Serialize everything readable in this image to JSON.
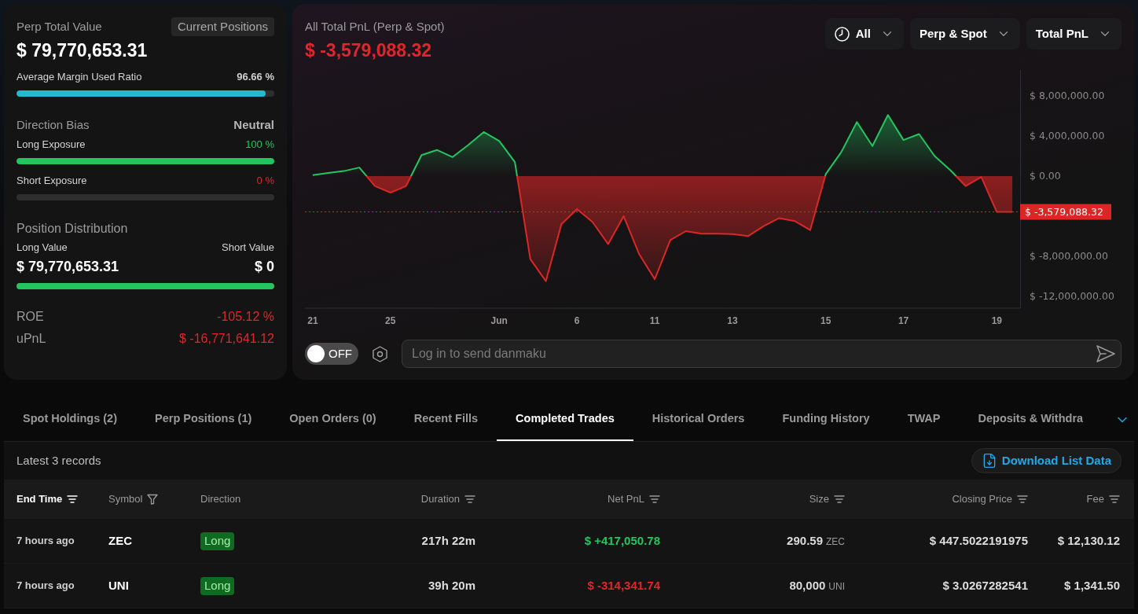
{
  "summary": {
    "title": "Perp Total Value",
    "badge": "Current Positions",
    "value": "$ 79,770,653.31",
    "margin": {
      "label": "Average Margin Used Ratio",
      "reading": "96.66 %",
      "level": 0.9666
    },
    "bias": {
      "label": "Direction Bias",
      "value": "Neutral"
    },
    "exposures": [
      {
        "label": "Long Exposure",
        "reading": "100 %",
        "kind": "long",
        "level": 1
      },
      {
        "label": "Short Exposure",
        "reading": "0 %",
        "kind": "short",
        "level": 0
      }
    ],
    "distribution": {
      "title": "Position Distribution",
      "long_label": "Long Value",
      "short_label": "Short Value",
      "long_value": "$ 79,770,653.31",
      "short_value": "$ 0",
      "level": 1
    },
    "metrics": [
      {
        "label": "ROE",
        "value": "-105.12 %",
        "kind": "loss"
      },
      {
        "label": "uPnL",
        "value": "$ -16,771,641.12",
        "kind": "loss"
      }
    ]
  },
  "pnl": {
    "value": {
      "text": "$ -3,579,088.32",
      "kind": "loss"
    },
    "filters": [
      {
        "label": "All",
        "kind": "period"
      },
      {
        "label": "Perp & Spot",
        "kind": "plain"
      },
      {
        "label": "Total PnL",
        "kind": "plain"
      }
    ],
    "chart_data": {
      "type": "area",
      "title": "All Total PnL (Perp & Spot)",
      "categories": [
        "21",
        null,
        null,
        null,
        null,
        "25",
        null,
        null,
        null,
        null,
        null,
        null,
        "Jun",
        null,
        null,
        null,
        null,
        "6",
        null,
        null,
        null,
        null,
        "11",
        null,
        null,
        null,
        null,
        "13",
        null,
        null,
        null,
        null,
        null,
        "15",
        null,
        null,
        null,
        null,
        "17",
        null,
        null,
        null,
        null,
        null,
        "19",
        null
      ],
      "series": [
        {
          "color": "#22c55e",
          "values": [
            100000,
            300000,
            500000,
            850000,
            -1000000,
            -1650000,
            -1000000,
            2100000,
            2600000,
            1900000,
            3100000,
            4400000,
            3500000,
            1400000,
            -8300000,
            -10500000,
            -4800000,
            -3300000,
            -4600000,
            -6800000,
            -4000000,
            -7800000,
            -10300000,
            -6400000,
            -5500000,
            -5750000,
            -5750000,
            -5800000,
            -6000000,
            -5000000,
            -4200000,
            -4500000,
            -5400000,
            200000,
            2400000,
            5400000,
            3000000,
            6100000,
            3600000,
            4200000,
            2000000,
            600000,
            -1000000,
            -100000,
            -3580000,
            -3580000
          ]
        }
      ],
      "ylim": [
        -13200000,
        10600000
      ],
      "yticks": [
        {
          "value": 8000000,
          "label": "$ 8,000,000.00"
        },
        {
          "value": 4000000,
          "label": "$ 4,000,000.00"
        },
        {
          "value": 0,
          "label": "$ 0.00"
        },
        {
          "value": -8000000,
          "label": "$ -8,000,000.00"
        },
        {
          "value": -12000000,
          "label": "$ -12,000,000.00"
        }
      ],
      "ref_lines": [
        {
          "axis": "y",
          "value": -3579088.32,
          "label": "$ -3,579,088.32"
        }
      ]
    },
    "danmaku": {
      "on": false,
      "label": "OFF",
      "placeholder": "Log in to send danmaku"
    }
  },
  "tabs": [
    {
      "label": "Spot Holdings (2)",
      "selected": false
    },
    {
      "label": "Perp Positions (1)",
      "selected": false
    },
    {
      "label": "Open Orders (0)",
      "selected": false
    },
    {
      "label": "Recent Fills",
      "selected": false
    },
    {
      "label": "Completed Trades",
      "selected": true
    },
    {
      "label": "Historical Orders",
      "selected": false
    },
    {
      "label": "Funding History",
      "selected": false
    },
    {
      "label": "TWAP",
      "selected": false
    },
    {
      "label": "Deposits & Withdra",
      "selected": false
    }
  ],
  "records": {
    "count": "Latest 3 records",
    "download": "Download List Data"
  },
  "table": {
    "columns": [
      {
        "label": "End Time",
        "kind": "sort",
        "selected": true
      },
      {
        "label": "Symbol",
        "kind": "filter",
        "selected": false
      },
      {
        "label": "Direction",
        "kind": "plain",
        "selected": false
      },
      {
        "label": "Duration",
        "kind": "sort",
        "selected": false
      },
      {
        "label": "Net PnL",
        "kind": "sort",
        "selected": false
      },
      {
        "label": "Size",
        "kind": "sort",
        "selected": false
      },
      {
        "label": "Closing Price",
        "kind": "sort",
        "selected": false
      },
      {
        "label": "Fee",
        "kind": "sort",
        "selected": false
      }
    ],
    "rows": [
      {
        "end_time": "7 hours ago",
        "symbol": "ZEC",
        "direction": {
          "text": "Long",
          "kind": "long"
        },
        "duration": "217h 22m",
        "net_pnl": {
          "text": "$ +417,050.78",
          "kind": "gain"
        },
        "size": "290.59",
        "unit": "ZEC",
        "closing_price": "$ 447.5022191975",
        "fee": "$ 12,130.12"
      },
      {
        "end_time": "7 hours ago",
        "symbol": "UNI",
        "direction": {
          "text": "Long",
          "kind": "long"
        },
        "duration": "39h 20m",
        "net_pnl": {
          "text": "$ -314,341.74",
          "kind": "loss"
        },
        "size": "80,000",
        "unit": "UNI",
        "closing_price": "$ 3.0267282541",
        "fee": "$ 1,341.50"
      }
    ]
  }
}
